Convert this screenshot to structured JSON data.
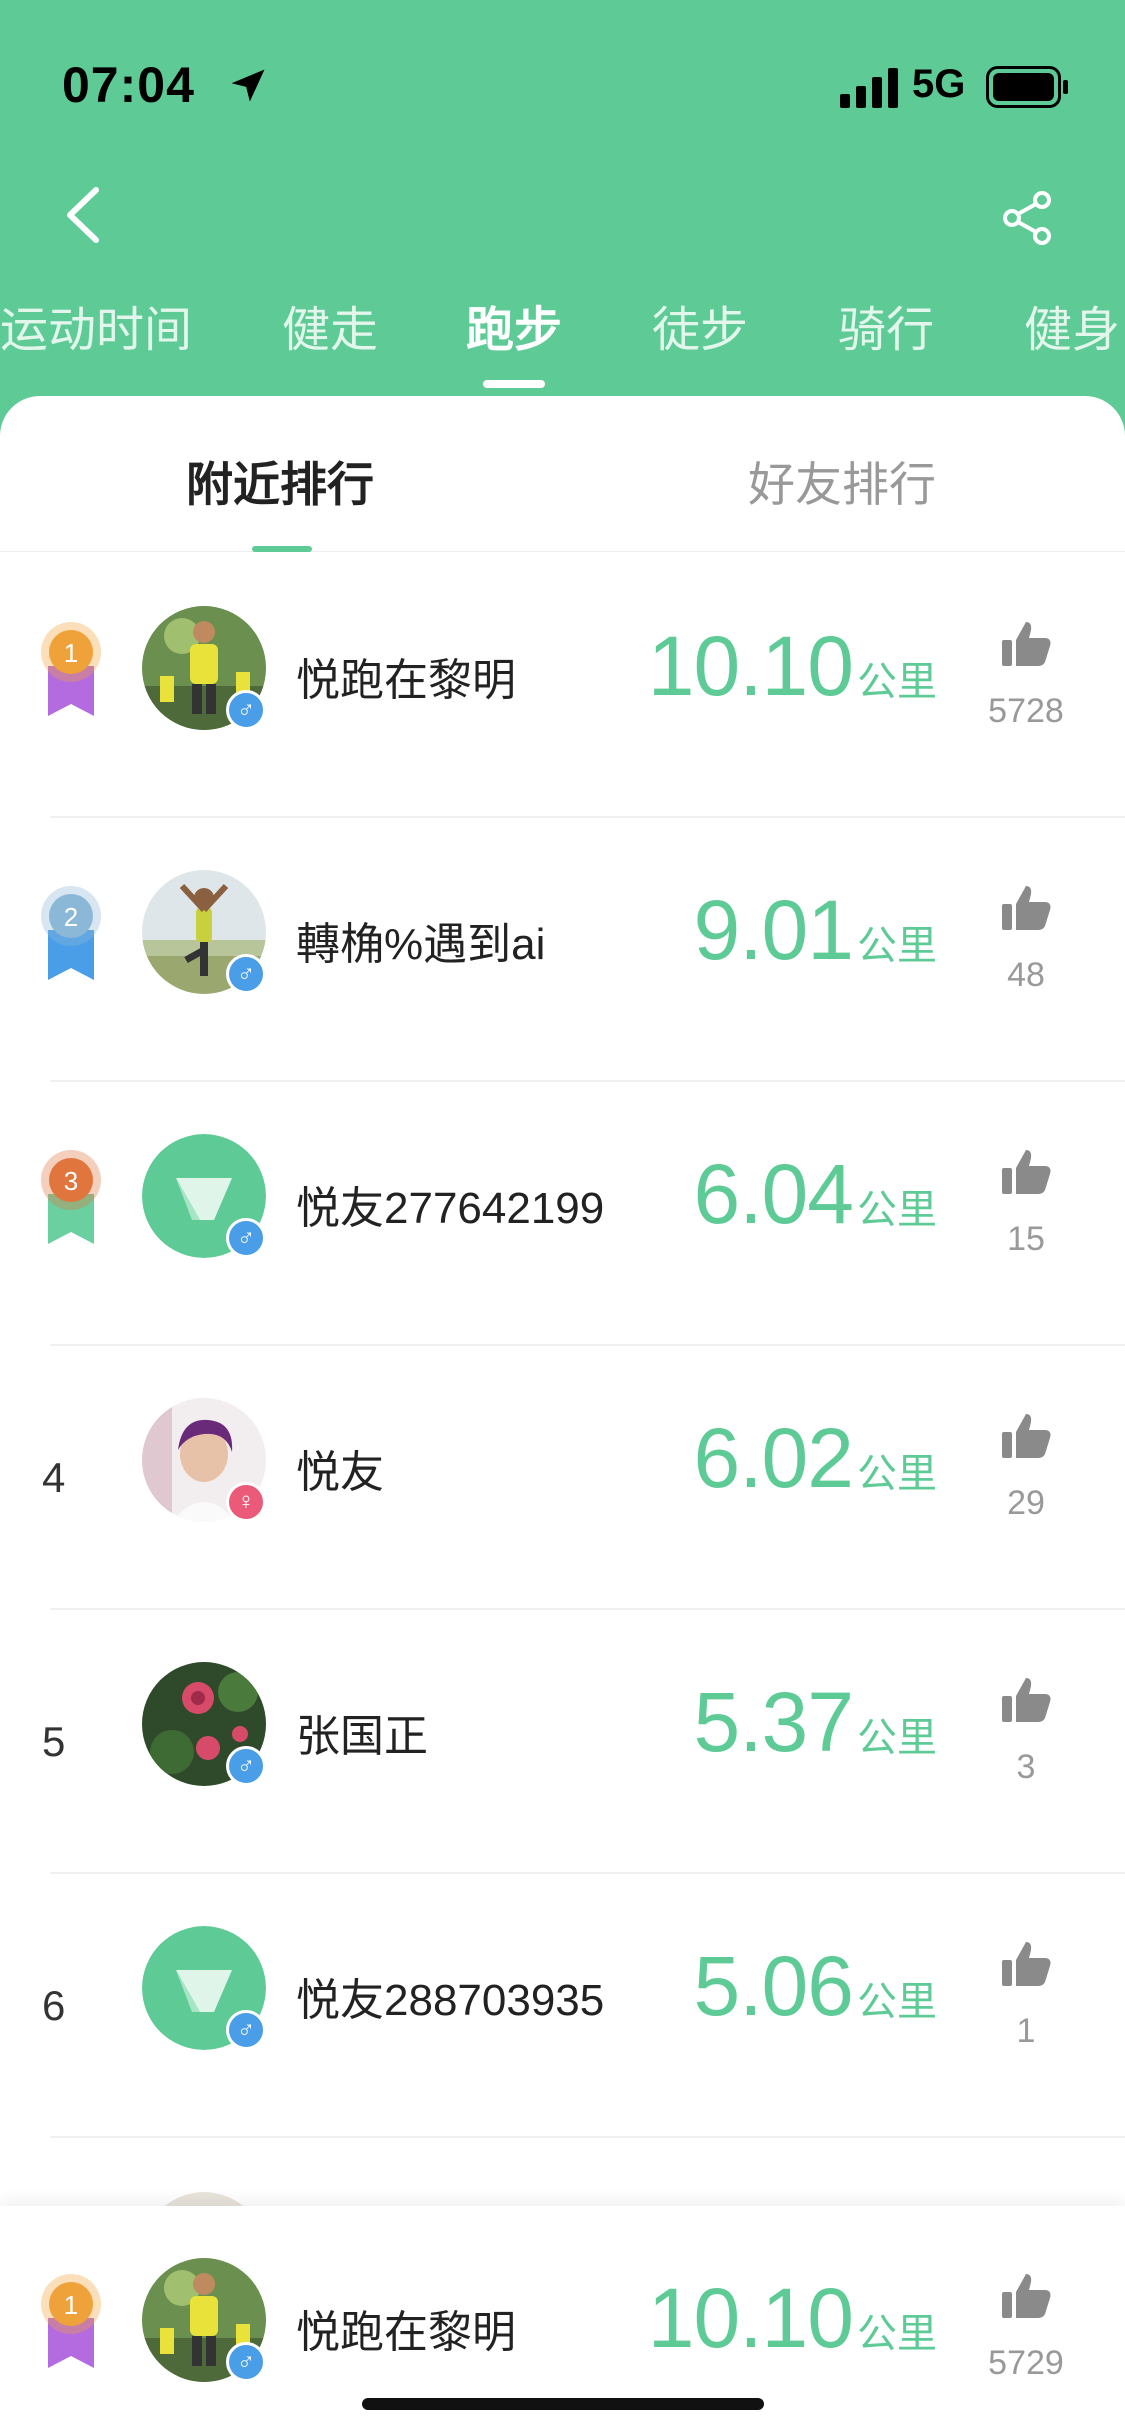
{
  "status_bar": {
    "time": "07:04",
    "network": "5G"
  },
  "nav": {
    "back_icon": "chevron-left-icon",
    "share_icon": "share-icon"
  },
  "sport_tabs": [
    {
      "label": "运动时间",
      "active": false
    },
    {
      "label": "健走",
      "active": false
    },
    {
      "label": "跑步",
      "active": true
    },
    {
      "label": "徒步",
      "active": false
    },
    {
      "label": "骑行",
      "active": false
    },
    {
      "label": "健身",
      "active": false
    }
  ],
  "rank_tabs": [
    {
      "label": "附近排行",
      "active": true
    },
    {
      "label": "好友排行",
      "active": false
    }
  ],
  "distance_unit": "公里",
  "rankings": [
    {
      "rank": "1",
      "medal": "gold",
      "name": "悦跑在黎明",
      "distance": "10.10",
      "likes": "5728",
      "gender": "male",
      "avatar": "photo-runner"
    },
    {
      "rank": "2",
      "medal": "silver",
      "name": "轉桷%遇到ai",
      "distance": "9.01",
      "likes": "48",
      "gender": "male",
      "avatar": "photo-yoga"
    },
    {
      "rank": "3",
      "medal": "bronze",
      "name": "悦友277642199",
      "distance": "6.04",
      "likes": "15",
      "gender": "male",
      "avatar": "logo-default"
    },
    {
      "rank": "4",
      "medal": "",
      "name": "悦友",
      "distance": "6.02",
      "likes": "29",
      "gender": "female",
      "avatar": "photo-woman"
    },
    {
      "rank": "5",
      "medal": "",
      "name": "张国正",
      "distance": "5.37",
      "likes": "3",
      "gender": "male",
      "avatar": "photo-flower"
    },
    {
      "rank": "6",
      "medal": "",
      "name": "悦友288703935",
      "distance": "5.06",
      "likes": "1",
      "gender": "male",
      "avatar": "logo-default"
    }
  ],
  "my_rank": {
    "rank": "1",
    "medal": "gold",
    "name": "悦跑在黎明",
    "distance": "10.10",
    "likes": "5729",
    "gender": "male",
    "avatar": "photo-runner"
  },
  "colors": {
    "accent": "#5ecb96",
    "gold": "#f0a23a",
    "silver": "#8cb8d8",
    "bronze": "#e0763e",
    "male": "#4a9ee8",
    "female": "#ec5a7a"
  }
}
